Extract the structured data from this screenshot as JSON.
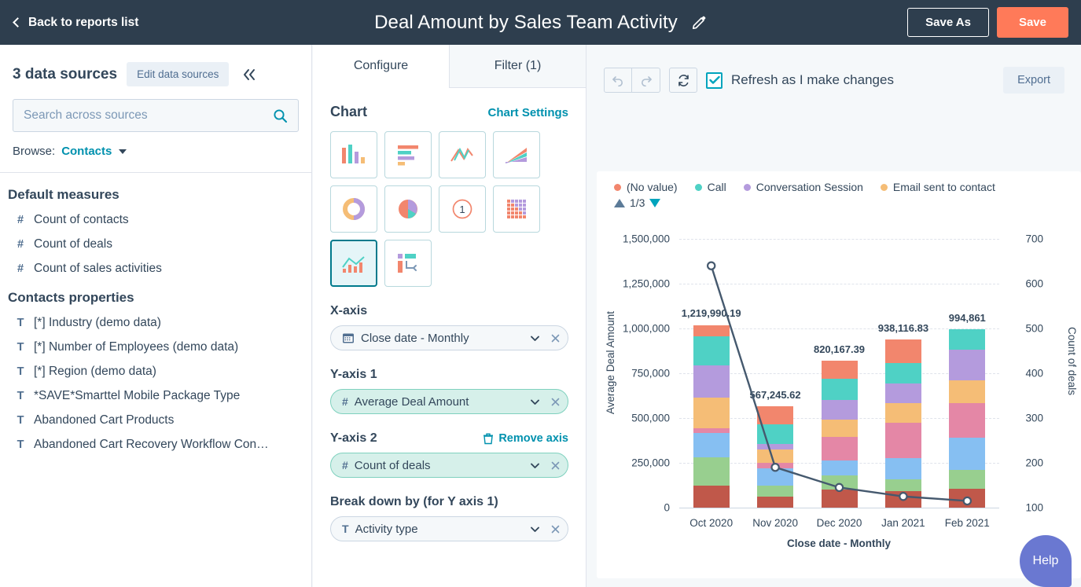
{
  "topbar": {
    "back_label": "Back to reports list",
    "title": "Deal Amount by Sales Team Activity",
    "save_as_label": "Save As",
    "save_label": "Save",
    "accent": "#ff7a59",
    "background": "#2e3e4e"
  },
  "sidebar": {
    "sources_count_label": "3 data sources",
    "edit_sources_label": "Edit data sources",
    "search_placeholder": "Search across sources",
    "search_value": "",
    "browse_label": "Browse:",
    "browse_value": "Contacts",
    "groups": [
      {
        "title": "Default measures",
        "items": [
          {
            "type": "#",
            "label": "Count of contacts"
          },
          {
            "type": "#",
            "label": "Count of deals"
          },
          {
            "type": "#",
            "label": "Count of sales activities"
          }
        ]
      },
      {
        "title": "Contacts properties",
        "items": [
          {
            "type": "T",
            "label": "[*] Industry (demo data)"
          },
          {
            "type": "T",
            "label": "[*] Number of Employees (demo data)"
          },
          {
            "type": "T",
            "label": "[*] Region (demo data)"
          },
          {
            "type": "T",
            "label": "*SAVE*Smarttel Mobile Package Type"
          },
          {
            "type": "T",
            "label": "Abandoned Cart Products"
          },
          {
            "type": "T",
            "label": "Abandoned Cart Recovery Workflow Con…"
          }
        ]
      }
    ]
  },
  "config": {
    "tabs": [
      {
        "label": "Configure",
        "active": true
      },
      {
        "label": "Filter (1)",
        "active": false
      }
    ],
    "chart_heading": "Chart",
    "chart_settings_link": "Chart Settings",
    "chart_types": [
      {
        "name": "vertical-bar-chart-icon",
        "selected": false
      },
      {
        "name": "horizontal-bar-chart-icon",
        "selected": false
      },
      {
        "name": "line-chart-icon",
        "selected": false
      },
      {
        "name": "area-chart-icon",
        "selected": false
      },
      {
        "name": "donut-chart-icon",
        "selected": false
      },
      {
        "name": "pie-chart-icon",
        "selected": false
      },
      {
        "name": "single-value-chart-icon",
        "selected": false
      },
      {
        "name": "heatmap-chart-icon",
        "selected": false
      },
      {
        "name": "combo-chart-icon",
        "selected": true
      },
      {
        "name": "pivot-table-icon",
        "selected": false
      }
    ],
    "x_axis": {
      "label": "X-axis",
      "type": "date",
      "value": "Close date - Monthly"
    },
    "y_axis_1": {
      "label": "Y-axis 1",
      "type": "#",
      "value": "Average Deal Amount"
    },
    "y_axis_2": {
      "label": "Y-axis 2",
      "type": "#",
      "value": "Count of deals",
      "remove_label": "Remove axis"
    },
    "breakdown": {
      "label": "Break down by (for Y axis 1)",
      "type": "T",
      "value": "Activity type"
    }
  },
  "toolbar": {
    "undo_icon": "undo-icon",
    "redo_icon": "redo-icon",
    "refresh_icon": "refresh-icon",
    "refresh_checkbox_label": "Refresh as I make changes",
    "refresh_checked": true,
    "export_label": "Export"
  },
  "help": {
    "label": "Help",
    "color": "#6a78d1"
  },
  "chart_data": {
    "type": "bar",
    "title": "",
    "xlabel": "Close date - Monthly",
    "ylabel": "Average Deal Amount",
    "y2label": "Count of deals",
    "grid": true,
    "legend_position": "top",
    "pager": "1/3",
    "categories": [
      "Oct 2020",
      "Nov 2020",
      "Dec 2020",
      "Jan 2021",
      "Feb 2021"
    ],
    "ylim": [
      0,
      1500000
    ],
    "yticks": [
      0,
      250000,
      500000,
      750000,
      1000000,
      1250000,
      1500000
    ],
    "ytick_labels": [
      "0",
      "250,000",
      "500,000",
      "750,000",
      "1,000,000",
      "1,250,000",
      "1,500,000"
    ],
    "y2lim": [
      100,
      700
    ],
    "y2ticks": [
      100,
      200,
      300,
      400,
      500,
      600,
      700
    ],
    "y2tick_labels": [
      "100",
      "200",
      "300",
      "400",
      "500",
      "600",
      "700"
    ],
    "bar_totals": [
      1219990.19,
      567245.62,
      820167.39,
      938116.83,
      994861
    ],
    "bar_total_labels": [
      "1,219,990.19",
      "567,245.62",
      "820,167.39",
      "938,116.83",
      "994,861"
    ],
    "legend": [
      {
        "name": "(No value)",
        "color": "#f2866d"
      },
      {
        "name": "Call",
        "color": "#4fd1c5"
      },
      {
        "name": "Conversation Session",
        "color": "#b49bdd"
      },
      {
        "name": "Email sent to contact",
        "color": "#f5bd76"
      }
    ],
    "stack_colors": [
      "#c0584a",
      "#98cf8f",
      "#86bff2",
      "#e487a6",
      "#f5bd76",
      "#b49bdd",
      "#4fd1c5",
      "#f2866d"
    ],
    "stacks": [
      {
        "category": "Oct 2020",
        "values": [
          125000,
          155000,
          135000,
          30000,
          170000,
          180000,
          160000,
          65000
        ]
      },
      {
        "category": "Nov 2020",
        "values": [
          60000,
          65000,
          95000,
          30000,
          75000,
          30000,
          110000,
          100000
        ]
      },
      {
        "category": "Dec 2020",
        "values": [
          100000,
          80000,
          85000,
          130000,
          95000,
          110000,
          120000,
          100000
        ]
      },
      {
        "category": "Jan 2021",
        "values": [
          90000,
          70000,
          115000,
          200000,
          110000,
          110000,
          110000,
          135000
        ]
      },
      {
        "category": "Feb 2021",
        "values": [
          105000,
          105000,
          180000,
          195000,
          125000,
          170000,
          115000,
          0
        ]
      }
    ],
    "line_series": {
      "name": "Count of deals",
      "values": [
        640,
        190,
        145,
        125,
        115
      ]
    }
  }
}
